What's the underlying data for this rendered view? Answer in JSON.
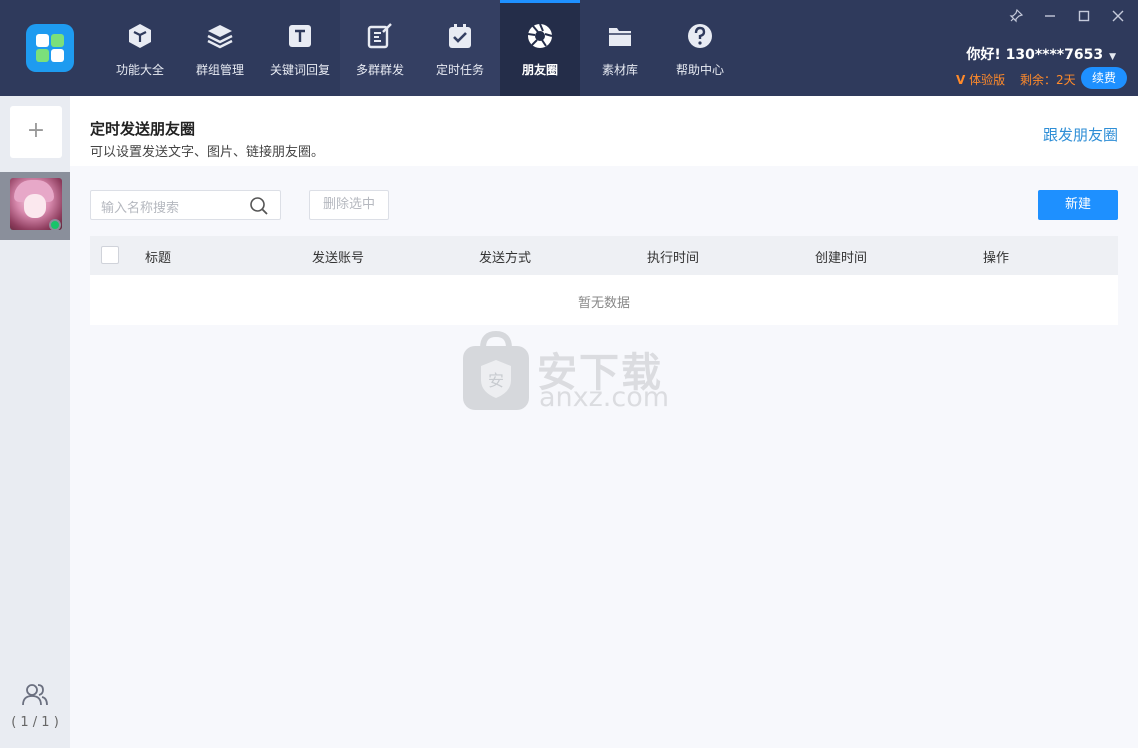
{
  "nav": {
    "items": [
      {
        "label": "功能大全",
        "icon": "cube-icon"
      },
      {
        "label": "群组管理",
        "icon": "layers-icon"
      },
      {
        "label": "关键词回复",
        "icon": "text-t-icon"
      },
      {
        "label": "多群群发",
        "icon": "edit-send-icon"
      },
      {
        "label": "定时任务",
        "icon": "calendar-check-icon"
      },
      {
        "label": "朋友圈",
        "icon": "aperture-icon"
      },
      {
        "label": "素材库",
        "icon": "folder-icon"
      },
      {
        "label": "帮助中心",
        "icon": "help-circle-icon"
      }
    ],
    "active_index": 5
  },
  "user": {
    "greeting": "你好! 130****7653",
    "trial_label": "体验版",
    "remaining": "剩余：2天",
    "renew_label": "续费"
  },
  "sidebar": {
    "add_symbol": "+",
    "account_count": "( 1 / 1 )"
  },
  "page": {
    "title": "定时发送朋友圈",
    "description": "可以设置发送文字、图片、链接朋友圈。",
    "follow_link": "跟发朋友圈"
  },
  "toolbar": {
    "search_placeholder": "输入名称搜索",
    "delete_selected_label": "删除选中",
    "new_label": "新建"
  },
  "table": {
    "columns": [
      "标题",
      "发送账号",
      "发送方式",
      "执行时间",
      "创建时间",
      "操作"
    ],
    "rows": [],
    "empty_text": "暂无数据"
  },
  "watermark": {
    "text": "安下载",
    "sub": "anxz.com",
    "badge": "安"
  },
  "colors": {
    "topbar": "#2f3a5c",
    "accent": "#1e90ff",
    "trial": "#ff8a2a",
    "online": "#18c46a"
  }
}
